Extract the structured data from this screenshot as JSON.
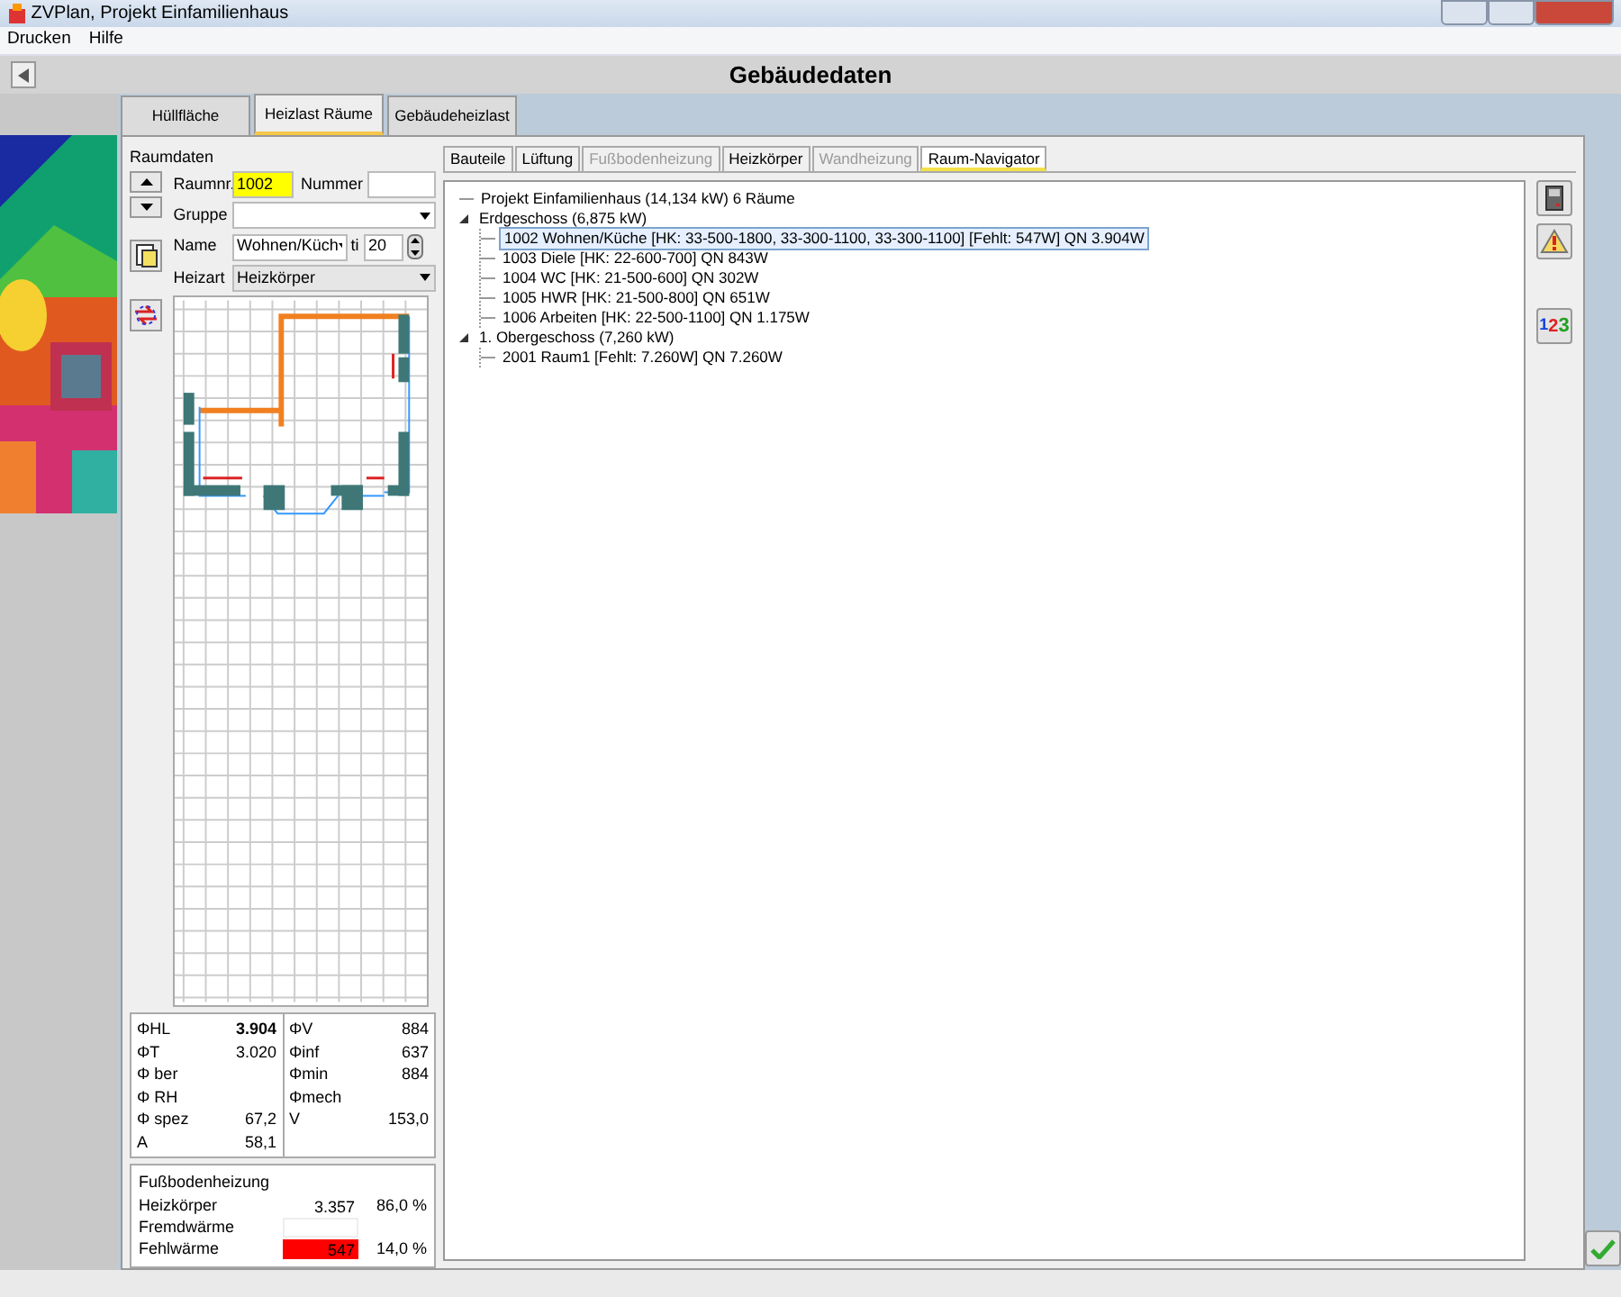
{
  "window": {
    "title": "ZVPlan, Projekt Einfamilienhaus"
  },
  "menu": [
    "Drucken",
    "Hilfe"
  ],
  "header": {
    "title": "Gebäudedaten"
  },
  "tabs": [
    {
      "label": "Hüllfläche",
      "selected": false
    },
    {
      "label": "Heizlast Räume",
      "selected": true
    },
    {
      "label": "Gebäudeheizlast",
      "selected": false
    }
  ],
  "room_data": {
    "legend": "Raumdaten",
    "room_no_label": "Raumnr.",
    "room_no": "1002",
    "number_label": "Nummer",
    "group_label": "Gruppe",
    "name_label": "Name",
    "name": "Wohnen/Küch",
    "ti_label": "ti",
    "ti": "20",
    "heating_label": "Heizart",
    "heating": "Heizkörper"
  },
  "stats_left": [
    {
      "label": "ΦHL",
      "value": "3.904",
      "emphasis": true
    },
    {
      "label": "ΦT",
      "value": "3.020",
      "emphasis": false
    },
    {
      "label": "Φ ber"
    },
    {
      "label": "Φ RH"
    },
    {
      "label": "Φ spez",
      "value": "67,2",
      "emphasis": false
    },
    {
      "label": "A",
      "value": "58,1",
      "emphasis": false
    }
  ],
  "stats_right": [
    {
      "label": "ΦV",
      "value": "884"
    },
    {
      "label": "Φinf",
      "value": "637"
    },
    {
      "label": "Φmin",
      "value": "884"
    },
    {
      "label": "Φmech"
    },
    {
      "label": "V",
      "value": "153,0"
    }
  ],
  "coverage": {
    "title": "Fußbodenheizung",
    "rows": [
      {
        "label": "Heizkörper",
        "value": "3.357",
        "percent": "86,0 %",
        "kind": "plain"
      },
      {
        "label": "Fremdwärme",
        "kind": "box"
      },
      {
        "label": "Fehlwärme",
        "value": "547",
        "percent": "14,0 %",
        "kind": "alert"
      }
    ]
  },
  "sub_tabs": [
    {
      "label": "Bauteile",
      "selected": false,
      "disabled": false
    },
    {
      "label": "Lüftung",
      "selected": false,
      "disabled": false
    },
    {
      "label": "Fußbodenheizung",
      "selected": false,
      "disabled": true
    },
    {
      "label": "Heizkörper",
      "selected": false,
      "disabled": false
    },
    {
      "label": "Wandheizung",
      "selected": false,
      "disabled": true
    },
    {
      "label": "Raum-Navigator",
      "selected": true,
      "disabled": false
    }
  ],
  "tree": [
    {
      "label": "Projekt Einfamilienhaus  (14,134 kW)  6 Räume",
      "selected": false
    },
    {
      "label": "Erdgeschoss  (6,875 kW)",
      "selected": false,
      "expanded": true,
      "children": [
        {
          "label": "1002 Wohnen/Küche   [HK: 33-500-1800, 33-300-1100, 33-300-1100] [Fehlt: 547W]  QN 3.904W",
          "selected": true
        },
        {
          "label": "1003 Diele   [HK: 22-600-700]  QN 843W",
          "selected": false
        },
        {
          "label": "1004 WC   [HK: 21-500-600]  QN 302W",
          "selected": false
        },
        {
          "label": "1005 HWR   [HK: 21-500-800]  QN 651W",
          "selected": false
        },
        {
          "label": "1006 Arbeiten   [HK: 22-500-1100]  QN 1.175W",
          "selected": false
        }
      ]
    },
    {
      "label": "1. Obergeschoss  (7,260 kW)",
      "selected": false,
      "expanded": true,
      "children": [
        {
          "label": "2001 Raum1   [Fehlt: 7.260W]  QN 7.260W",
          "selected": false
        }
      ]
    }
  ],
  "numbering_button": {
    "digits": [
      "1",
      "2",
      "3"
    ]
  }
}
